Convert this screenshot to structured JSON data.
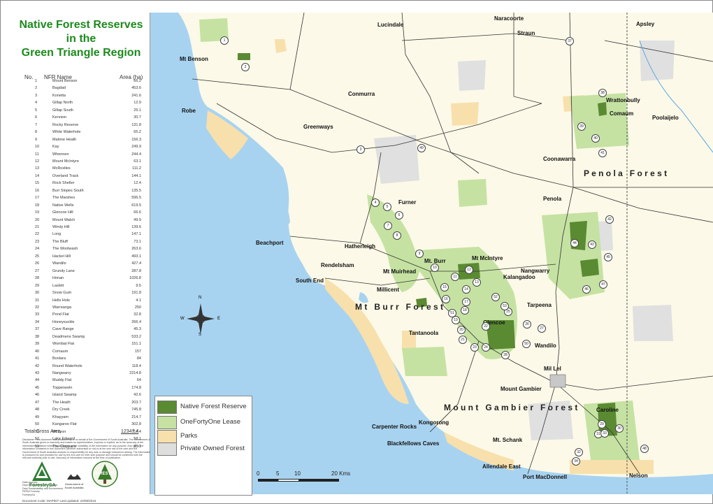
{
  "title": {
    "line1": "Native Forest Reserves",
    "line2": "in the",
    "line3": "Green Triangle Region"
  },
  "table_header": {
    "no": "No.",
    "name": "NFR Name",
    "area": "Area (ha)"
  },
  "reserves": [
    {
      "no": "1",
      "name": "Mount Benson",
      "area": "66.2"
    },
    {
      "no": "2",
      "name": "Bagdad",
      "area": "453.6"
    },
    {
      "no": "3",
      "name": "Konetta",
      "area": "241.6"
    },
    {
      "no": "4",
      "name": "Gillap North",
      "area": "12.9"
    },
    {
      "no": "5",
      "name": "Gillap South",
      "area": "25.1"
    },
    {
      "no": "6",
      "name": "Kennion",
      "area": "30.7"
    },
    {
      "no": "7",
      "name": "Rocky Reserve",
      "area": "131.8"
    },
    {
      "no": "8",
      "name": "White Waterhole",
      "area": "65.2"
    },
    {
      "no": "9",
      "name": "Malone Heath",
      "area": "156.3"
    },
    {
      "no": "10",
      "name": "Kay",
      "area": "249.9"
    },
    {
      "no": "11",
      "name": "Whennen",
      "area": "244.4"
    },
    {
      "no": "12",
      "name": "Mount McIntyre",
      "area": "63.1"
    },
    {
      "no": "13",
      "name": "McRostles",
      "area": "111.2"
    },
    {
      "no": "14",
      "name": "Overland Track",
      "area": "144.1"
    },
    {
      "no": "15",
      "name": "Rock Shelter",
      "area": "12.4"
    },
    {
      "no": "16",
      "name": "Burr Slopes South",
      "area": "135.5"
    },
    {
      "no": "17",
      "name": "The Marshes",
      "area": "596.5"
    },
    {
      "no": "18",
      "name": "Native Wells",
      "area": "619.5"
    },
    {
      "no": "19",
      "name": "Glencoe Hill",
      "area": "66.6"
    },
    {
      "no": "20",
      "name": "Mount Watch",
      "area": "49.9"
    },
    {
      "no": "21",
      "name": "Windy Hill",
      "area": "139.6"
    },
    {
      "no": "22",
      "name": "Long",
      "area": "147.1"
    },
    {
      "no": "23",
      "name": "The Bluff",
      "area": "73.1"
    },
    {
      "no": "24",
      "name": "The Woolwash",
      "area": "263.6"
    },
    {
      "no": "25",
      "name": "Hackel Hill",
      "area": "493.1"
    },
    {
      "no": "26",
      "name": "Wandilo",
      "area": "427.4"
    },
    {
      "no": "27",
      "name": "Grundy Lane",
      "area": "287.8"
    },
    {
      "no": "28",
      "name": "Honan",
      "area": "1026.8"
    },
    {
      "no": "29",
      "name": "Laslett",
      "area": "9.5"
    },
    {
      "no": "30",
      "name": "Snow Gum",
      "area": "191.8"
    },
    {
      "no": "31",
      "name": "Hells Hole",
      "area": "4.1"
    },
    {
      "no": "32",
      "name": "Warreanga",
      "area": "250"
    },
    {
      "no": "33",
      "name": "Pond Flat",
      "area": "32.8"
    },
    {
      "no": "34",
      "name": "Honeysuckle",
      "area": "266.4"
    },
    {
      "no": "37",
      "name": "Cave Range",
      "area": "45.3"
    },
    {
      "no": "38",
      "name": "Deadmens Swamp",
      "area": "533.2"
    },
    {
      "no": "39",
      "name": "Wombat Flat",
      "area": "151.1"
    },
    {
      "no": "40",
      "name": "Comaum",
      "area": "157"
    },
    {
      "no": "41",
      "name": "Boolara",
      "area": "84"
    },
    {
      "no": "42",
      "name": "Round Waterhole",
      "area": "118.4"
    },
    {
      "no": "43",
      "name": "Nangwarry",
      "area": "2214.8"
    },
    {
      "no": "44",
      "name": "Muddy Flat",
      "area": "64"
    },
    {
      "no": "45",
      "name": "Toppeneeln",
      "area": "174.8"
    },
    {
      "no": "46",
      "name": "Island Swamp",
      "area": "42.6"
    },
    {
      "no": "47",
      "name": "The Heath",
      "area": "203.7"
    },
    {
      "no": "48",
      "name": "Dry Creek",
      "area": "745.8"
    },
    {
      "no": "49",
      "name": "Khayyam",
      "area": "214.7"
    },
    {
      "no": "50",
      "name": "Kangaroo Flat",
      "area": "302.8"
    },
    {
      "no": "51",
      "name": "Mt Lyon",
      "area": "117.4"
    },
    {
      "no": "52",
      "name": "Lake Edward",
      "area": "58.1"
    },
    {
      "no": "53",
      "name": "The Claypans",
      "area": "35.1"
    }
  ],
  "total": {
    "label": "Total Gross Area",
    "value": "12347.4"
  },
  "disclaimer": "Disclaimer: This document was produced by or on behalf of the Government of South Australia. The Government of South Australia gives no warranty and makes no representation, express or implied, as to the accuracy of the information contained within this document or the suitability of the information for any purpose. Any use of the information contained in this document (whether authorised or not) is at the sole risk of the user and the Government of South Australia accepts no responsibility for any loss or damage howsoever arising. The information is produced for and provided for use by the end user for their sole purpose and should be confirmed with the relevant authority prior to use. Accuracy of information ensured at the time of publication.",
  "address": {
    "line1": "Data sources:",
    "line2": "Dept Environment and Heritage",
    "line3": "Dept Sustainability and Environment",
    "line4": "PIRSA Forestry",
    "line5": "ForestrySA"
  },
  "doc_code": "Document Code: MAP007    Last Updated: 24/08/2016",
  "logos": {
    "forestrysa": "ForestrySA",
    "govt": "Government of South Australia",
    "forestry": "FORESTRY"
  },
  "legend": [
    {
      "label": "Native Forest Reserve",
      "color": "#5a8a32"
    },
    {
      "label": "OneFortyOne Lease",
      "color": "#c5e2a2"
    },
    {
      "label": "Parks",
      "color": "#f8e0ac"
    },
    {
      "label": "Private Owned Forest",
      "color": "#dedede"
    }
  ],
  "scale": {
    "t0": "0",
    "t1": "5",
    "t2": "10",
    "t3": "20 Kms"
  },
  "compass": {
    "n": "N",
    "s": "S",
    "e": "E",
    "w": "W"
  },
  "region_labels": {
    "penola_forest": "P e n o l a   F o r e s t",
    "mt_burr_forest": "M t   B u r r   F o r e s t",
    "mount_gambier_forest": "M o u n t   G a m b i e r   F o r e s t"
  },
  "towns": [
    "Naracoorte",
    "Lucindale",
    "Apsley",
    "Straun",
    "Mt Benson",
    "Conmurra",
    "Wrattonbully",
    "Robe",
    "Comaum",
    "Poolaijelo",
    "Greenways",
    "Coonawarra",
    "Penola",
    "Furner",
    "Beachport",
    "Hatherleigh",
    "Mt McIntyre",
    "Rendelsham",
    "Mt. Burr",
    "Nangwarry",
    "Mt Muirhead",
    "Kalangadoo",
    "South End",
    "Millicent",
    "Tarpeena",
    "Glencoe",
    "Tantanoola",
    "Wandilo",
    "Mil Lel",
    "Mount Gambier",
    "Caroline",
    "Kongorong",
    "Carpenter Rocks",
    "Mt. Schank",
    "Blackfellows Caves",
    "Allendale East",
    "Port MacDonnell",
    "Nelson"
  ]
}
